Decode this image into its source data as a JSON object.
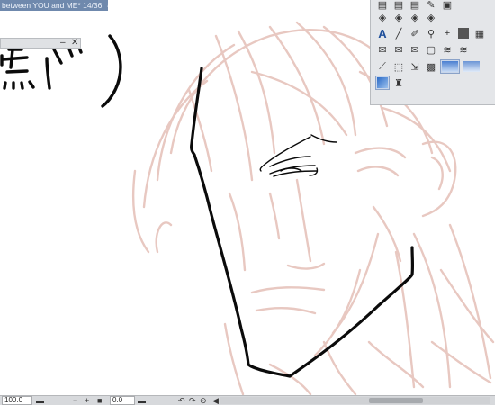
{
  "document": {
    "tab_title": "between YOU and ME* 14/36",
    "tab_close_icon": "✱"
  },
  "canvas": {
    "handwritten_text": "熊げ)"
  },
  "mini_window": {
    "minimize_icon": "–",
    "close_icon": "✕"
  },
  "tool_palette": {
    "rows": [
      [
        "layer-icon",
        "layer-icon",
        "layer-icon",
        "brush-icon",
        "text-icon"
      ],
      [
        "layer-stack-icon",
        "layer-stack-icon",
        "layer-stack-icon",
        "layer-stack-icon"
      ],
      [
        "text-tool-icon",
        "pen-tool-icon",
        "pencil-tool-icon",
        "eyedropper-icon",
        "crosshair-icon",
        "fill-icon",
        "pattern-icon"
      ],
      [
        "speech-balloon-icon",
        "speech-balloon-icon",
        "speech-balloon-icon",
        "frame-icon",
        "ruler-icon",
        "ruler-icon"
      ],
      [
        "line-tool-icon",
        "select-icon",
        "operation-icon",
        "effect-icon",
        "gradient-blue-icon",
        "gradient-blue-icon"
      ],
      [
        "layer-color-icon",
        "stamp-icon"
      ]
    ]
  },
  "status_bar": {
    "zoom_value": "100.0",
    "rotation_value": "0.0",
    "zoom_out_icon": "−",
    "zoom_in_icon": "+",
    "fit_icon": "■",
    "rotate_left_icon": "↶",
    "rotate_right_icon": "↷",
    "reset_rotation_icon": "⊙",
    "flip_icon": "◀"
  },
  "colors": {
    "sketch": "#e7c9c2",
    "ink": "#0b0b0b",
    "tab_bg": "#6f89ad",
    "active_tool": "#c9d6ea"
  }
}
